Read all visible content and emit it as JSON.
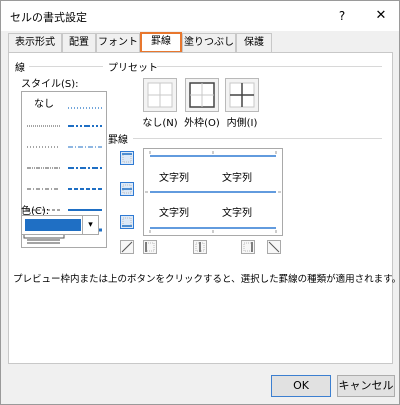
{
  "window": {
    "title": "セルの書式設定",
    "help_glyph": "?",
    "close_glyph": "✕"
  },
  "tabs": [
    {
      "label": "表示形式"
    },
    {
      "label": "配置"
    },
    {
      "label": "フォント"
    },
    {
      "label": "罫線",
      "active": true
    },
    {
      "label": "塗りつぶし"
    },
    {
      "label": "保護"
    }
  ],
  "line": {
    "group_label": "線",
    "style_label": "スタイル(S):",
    "none_label": "なし",
    "color_label": "色(C):",
    "color_value": "#1f6fc4",
    "dropdown_glyph": "▾"
  },
  "presets": {
    "group_label": "プリセット",
    "items": [
      {
        "label": "なし(N)",
        "icon": "preset-none-icon"
      },
      {
        "label": "外枠(O)",
        "icon": "preset-outline-icon"
      },
      {
        "label": "内側(I)",
        "icon": "preset-inside-icon"
      }
    ]
  },
  "border": {
    "group_label": "罫線",
    "preview_text": "文字列",
    "accent_color": "#2f7ad3"
  },
  "note": "プレビュー枠内または上のボタンをクリックすると、選択した罫線の種類が適用されます。",
  "buttons": {
    "ok": "OK",
    "cancel": "キャンセル"
  }
}
